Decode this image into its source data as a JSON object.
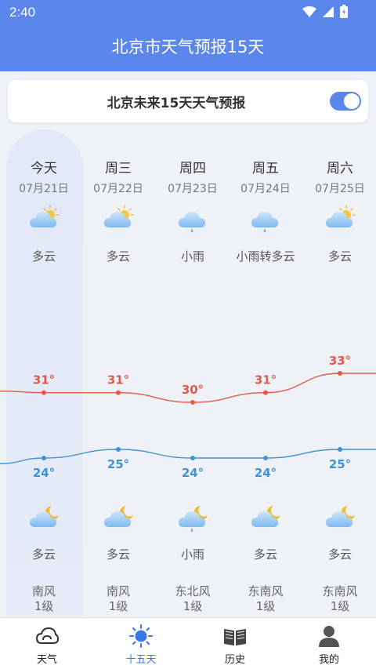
{
  "status": {
    "time": "2:40"
  },
  "header": {
    "title": "北京市天气预报15天"
  },
  "toggle": {
    "label": "北京未来15天天气预报",
    "on": true
  },
  "colors": {
    "accent": "#5b86ec",
    "high_line": "#e05a4a",
    "low_line": "#3f93d2"
  },
  "days": [
    {
      "name": "今天",
      "date": "07月21日",
      "day_cond": "多云",
      "day_icon": "partly-cloudy-day-icon",
      "high": "31°",
      "low": "24°",
      "night_cond": "多云",
      "night_icon": "partly-cloudy-night-icon",
      "wind_dir": "南风",
      "wind_level": "1级"
    },
    {
      "name": "周三",
      "date": "07月22日",
      "day_cond": "多云",
      "day_icon": "partly-cloudy-day-icon",
      "high": "31°",
      "low": "25°",
      "night_cond": "多云",
      "night_icon": "partly-cloudy-night-icon",
      "wind_dir": "南风",
      "wind_level": "1级"
    },
    {
      "name": "周四",
      "date": "07月23日",
      "day_cond": "小雨",
      "day_icon": "light-rain-icon",
      "high": "30°",
      "low": "24°",
      "night_cond": "小雨",
      "night_icon": "rain-night-icon",
      "wind_dir": "东北风",
      "wind_level": "1级"
    },
    {
      "name": "周五",
      "date": "07月24日",
      "day_cond": "小雨转多云",
      "day_icon": "light-rain-icon",
      "high": "31°",
      "low": "24°",
      "night_cond": "多云",
      "night_icon": "partly-cloudy-night-icon",
      "wind_dir": "东南风",
      "wind_level": "1级"
    },
    {
      "name": "周六",
      "date": "07月25日",
      "day_cond": "多云",
      "day_icon": "partly-cloudy-day-icon",
      "high": "33°",
      "low": "25°",
      "night_cond": "多云",
      "night_icon": "partly-cloudy-night-icon",
      "wind_dir": "东南风",
      "wind_level": "1级"
    }
  ],
  "temps": {
    "high_values": [
      31,
      31,
      30,
      31,
      33
    ],
    "low_values": [
      24,
      25,
      24,
      24,
      25
    ]
  },
  "tabs": [
    {
      "label": "天气",
      "icon": "cloud-outline-icon",
      "active": false
    },
    {
      "label": "十五天",
      "icon": "sun-icon",
      "active": true
    },
    {
      "label": "历史",
      "icon": "book-icon",
      "active": false
    },
    {
      "label": "我的",
      "icon": "user-icon",
      "active": false
    }
  ]
}
